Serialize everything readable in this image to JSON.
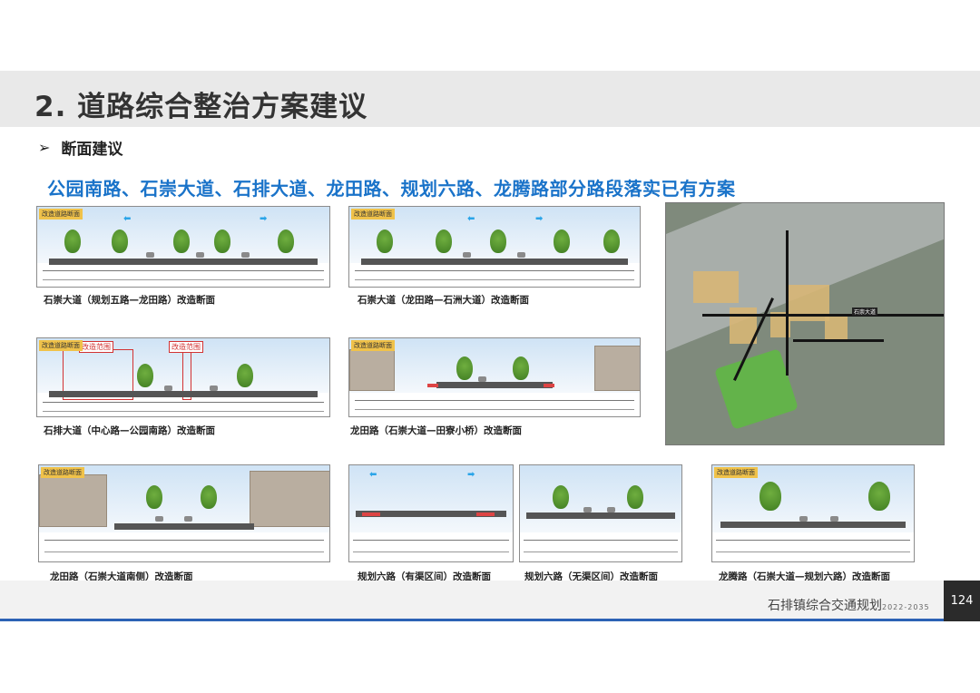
{
  "header": {
    "title": "2. 道路综合整治方案建议"
  },
  "section": {
    "bullet": "➢",
    "label": "断面建议"
  },
  "headline": "公园南路、石崇大道、石排大道、龙田路、规划六路、龙腾路部分路段落实已有方案",
  "panels": [
    {
      "caption": "石崇大道（规划五路—龙田路）改造断面",
      "tag": "改造道路断面"
    },
    {
      "caption": "石崇大道（龙田路—石洲大道）改造断面",
      "tag": "改造道路断面"
    },
    {
      "caption": "石排大道（中心路—公园南路）改造断面",
      "tag": "改造道路断面",
      "scope_a": "改造范围",
      "scope_b": "改造范围"
    },
    {
      "caption": "龙田路（石崇大道—田寮小桥）改造断面",
      "tag": "改造道路断面"
    },
    {
      "caption": "龙田路（石崇大道南侧）改造断面",
      "tag": "改造道路断面"
    },
    {
      "caption": "规划六路（有渠区间）改造断面"
    },
    {
      "caption": "规划六路（无渠区间）改造断面"
    },
    {
      "caption": "龙腾路（石崇大道—规划六路）改造断面",
      "tag": "改造道路断面"
    }
  ],
  "map": {
    "road_label": "石崇大道"
  },
  "footer": {
    "doc_title": "石排镇综合交通规划",
    "years": "2022-2035",
    "page_number": "124"
  },
  "colors": {
    "accent_blue": "#1a73c9",
    "footer_blue": "#2c62b5",
    "scope_red": "#d23232"
  }
}
